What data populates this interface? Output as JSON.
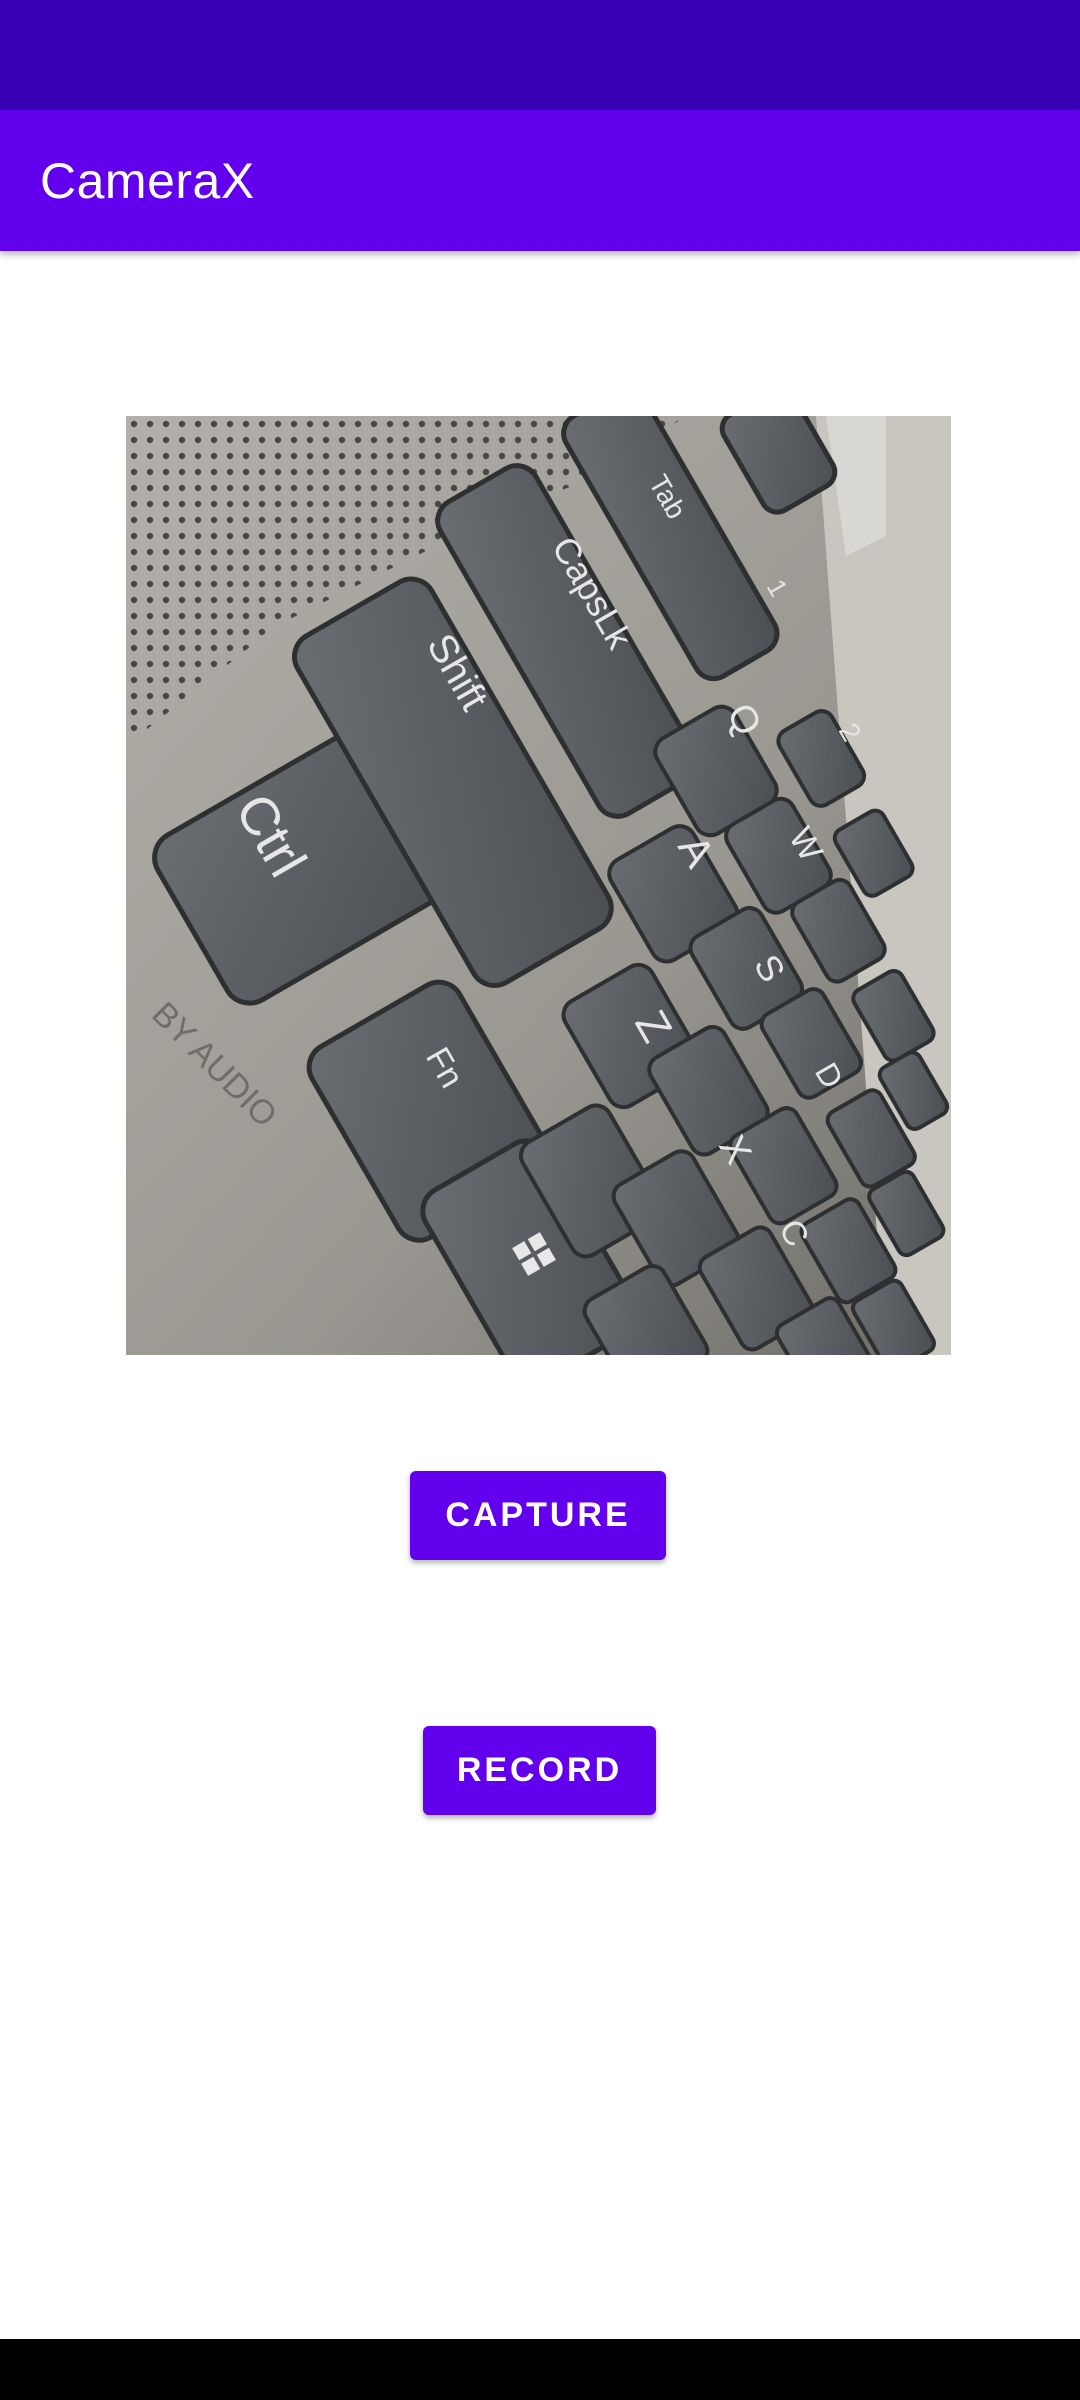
{
  "status_bar": {
    "color": "#3700b3"
  },
  "app_bar": {
    "title": "CameraX",
    "color": "#6200ee"
  },
  "preview": {
    "description_icon": "camera-preview",
    "key_labels": {
      "ctrl": "Ctrl",
      "shift": "Shift",
      "capslk": "CapsLk",
      "tab": "Tab",
      "fn": "Fn",
      "q": "Q",
      "a": "A",
      "z": "Z",
      "w": "W",
      "s": "S",
      "x": "X",
      "d": "D",
      "c": "C",
      "two": "2",
      "one": "1"
    },
    "imprint": "BY AUDIO"
  },
  "buttons": {
    "capture_label": "CAPTURE",
    "record_label": "RECORD"
  },
  "nav_bar": {
    "color": "#000000"
  }
}
